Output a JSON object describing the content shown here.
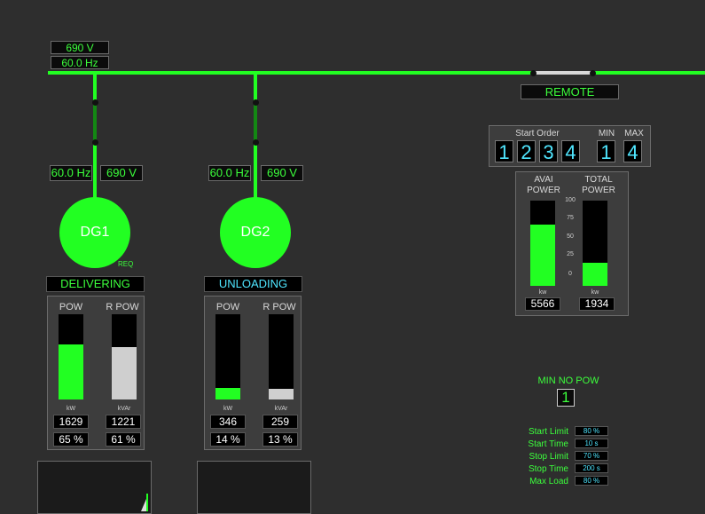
{
  "bus": {
    "voltage": "690 V",
    "frequency": "60.0 Hz",
    "mode_label": "REMOTE"
  },
  "generators": [
    {
      "name": "DG1",
      "frequency": "60.0 Hz",
      "voltage": "690 V",
      "req_label": "REQ",
      "status": "DELIVERING",
      "pow_label": "POW",
      "rpow_label": "R POW",
      "pow_unit": "kW",
      "rpow_unit": "kVAr",
      "pow_value": "1629",
      "rpow_value": "1221",
      "pow_pct": "65 %",
      "rpow_pct": "61 %",
      "pow_level": 0.65,
      "rpow_level": 0.61
    },
    {
      "name": "DG2",
      "frequency": "60.0 Hz",
      "voltage": "690 V",
      "status": "UNLOADING",
      "pow_label": "POW",
      "rpow_label": "R POW",
      "pow_unit": "kW",
      "rpow_unit": "kVAr",
      "pow_value": "346",
      "rpow_value": "259",
      "pow_pct": "14 %",
      "rpow_pct": "13 %",
      "pow_level": 0.14,
      "rpow_level": 0.13
    }
  ],
  "start_order": {
    "label": "Start Order",
    "order": [
      "1",
      "2",
      "3",
      "4"
    ],
    "min_label": "MIN",
    "max_label": "MAX",
    "min": "1",
    "max": "4"
  },
  "power_panel": {
    "avail_label_1": "AVAI",
    "avail_label_2": "POWER",
    "total_label_1": "TOTAL",
    "total_label_2": "POWER",
    "ticks": [
      "100",
      "75",
      "50",
      "25",
      "0"
    ],
    "unit": "kw",
    "avail_value": "5566",
    "total_value": "1934",
    "avail_level": 0.72,
    "total_level": 0.27
  },
  "min_no_pow": {
    "label": "MIN NO POW",
    "value": "1"
  },
  "limits": [
    {
      "label": "Start Limit",
      "value": "80 %"
    },
    {
      "label": "Start Time",
      "value": "10 s"
    },
    {
      "label": "Stop Limit",
      "value": "70 %"
    },
    {
      "label": "Stop Time",
      "value": "200 s"
    },
    {
      "label": "Max Load",
      "value": "80 %"
    }
  ],
  "colors": {
    "green": "#22ff22",
    "cyan": "#4fe6ff",
    "background": "#2e2e2e"
  }
}
